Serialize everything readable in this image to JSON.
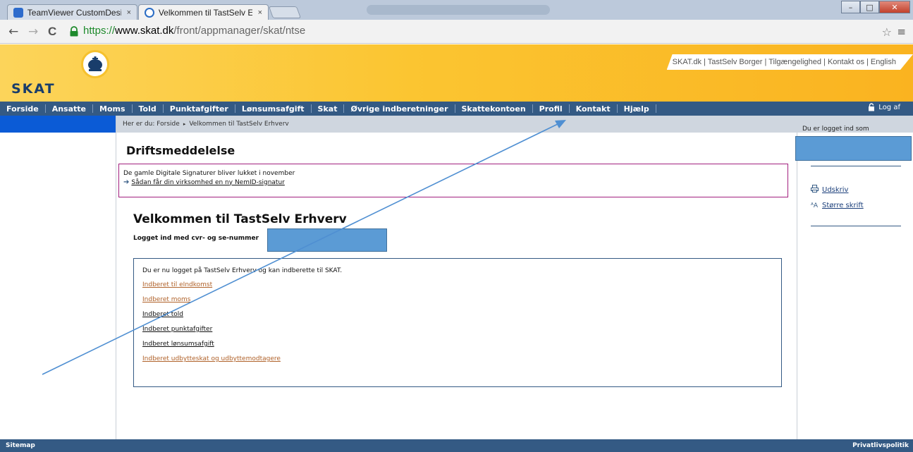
{
  "browser": {
    "tabs": [
      {
        "label": "TeamViewer CustomDesig",
        "close": "×",
        "favicon_color": "#2d6bcc"
      },
      {
        "label": "Velkommen til TastSelv Er",
        "close": "×",
        "favicon_color": "#2a6cc4"
      }
    ],
    "window_controls": {
      "minimize": "–",
      "maximize": "□",
      "close": "✕"
    },
    "nav": {
      "back": "←",
      "forward": "→",
      "reload": "C"
    },
    "url": {
      "proto": "https://",
      "host": "www.skat.dk",
      "path": "/front/appmanager/skat/ntse"
    },
    "star": "☆",
    "menu": "≡"
  },
  "header": {
    "logo_text": "SKAT",
    "crown_icon": "crown-icon",
    "top_links": "SKAT.dk | TastSelv Borger | Tilgængelighed | Kontakt os | English"
  },
  "mainmenu": {
    "items": [
      "Forside",
      "Ansatte",
      "Moms",
      "Told",
      "Punktafgifter",
      "Lønsumsafgift",
      "Skat",
      "Øvrige indberetninger",
      "Skattekontoen",
      "Profil",
      "Kontakt",
      "Hjælp"
    ],
    "logout": "Log af"
  },
  "breadcrumb": {
    "prefix": "Her er du:",
    "home": "Forside",
    "current": "Velkommen til TastSelv Erhverv",
    "separator": "▸"
  },
  "right": {
    "logged_in_as": "Du er logget ind som",
    "print": "Udskriv",
    "bigger_text": "Større skrift"
  },
  "drift": {
    "title": "Driftsmeddelelse",
    "message": "De gamle Digitale Signaturer bliver lukket i november",
    "link": "Sådan får din virksomhed en ny NemID-signatur"
  },
  "main": {
    "welcome": "Velkommen til TastSelv Erhverv",
    "cvr_label": "Logget ind med cvr- og se-nummer",
    "intro": "Du er nu logget på TastSelv Erhverv og kan indberette til SKAT.",
    "links": [
      {
        "label": "Indberet til eIndkomst",
        "color": "#b0622a"
      },
      {
        "label": "Indberet moms",
        "color": "#b0622a"
      },
      {
        "label": "Indberet told",
        "color": "#111111"
      },
      {
        "label": "Indberet punktafgifter",
        "color": "#111111"
      },
      {
        "label": "Indberet lønsumsafgift",
        "color": "#111111"
      },
      {
        "label": "Indberet udbytteskat og udbyttemodtagere",
        "color": "#b0622a"
      }
    ]
  },
  "footer": {
    "left": "Sitemap",
    "right": "Privatlivspolitik"
  },
  "colors": {
    "menu_bar": "#345a84",
    "header_yellow": "#fbc531",
    "redaction_blue": "#5b9bd5",
    "drift_border": "#a21f7e"
  }
}
